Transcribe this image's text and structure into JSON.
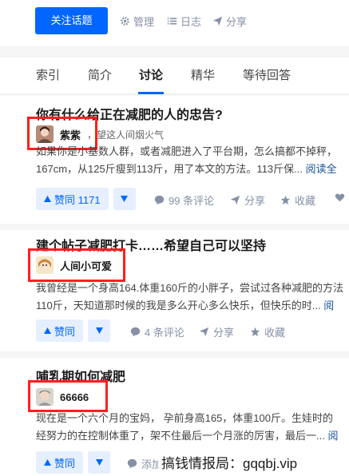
{
  "topbar": {
    "follow_label": "关注话题",
    "manage_label": "管理",
    "log_label": "日志",
    "share_label": "分享"
  },
  "tabs": [
    {
      "label": "索引"
    },
    {
      "label": "简介"
    },
    {
      "label": "讨论"
    },
    {
      "label": "精华"
    },
    {
      "label": "等待回答"
    }
  ],
  "answers": [
    {
      "title": "你有什么给正在减肥的人的忠告?",
      "author": "紫紫",
      "bio": "，望这人间烟火气",
      "excerpt_lines": [
        "如果你是小基数人群，或者减肥进入了平台期，怎么搞都不掉秤，",
        "167cm，从125斤瘦到113斤，用了本文的方法。113斤保..."
      ],
      "read_all": "阅读全",
      "upvote": "赞同 1171",
      "comments": "99 条评论",
      "share": "分享",
      "favorite": "收藏"
    },
    {
      "title": "建个帖子减肥打卡……希望自己可以坚持",
      "author": "人间小可爱",
      "bio": "",
      "excerpt_lines": [
        "我曾经是一个身高164.体重160斤的小胖子，尝试过各种减肥的方法",
        "110斤，天知道那时候的我是多么开心多么快乐，但快乐的时..."
      ],
      "read_all": "阅",
      "upvote": "赞同",
      "comments": "4 条评论",
      "share": "分享",
      "favorite": "收藏"
    },
    {
      "title": "哺乳期如何减肥",
      "author": "66666",
      "bio": "",
      "excerpt_lines": [
        "现在是一个六个月的宝妈， 孕前身高165，体重100斤。生娃时的",
        "经努力的在控制体重了，架不住最后一个月涨的厉害，最后一..."
      ],
      "read_all": "阅",
      "upvote": "赞同",
      "comments": "添加",
      "share": "",
      "favorite": ""
    }
  ],
  "watermark": "搞钱情报局：gqqbj.vip"
}
